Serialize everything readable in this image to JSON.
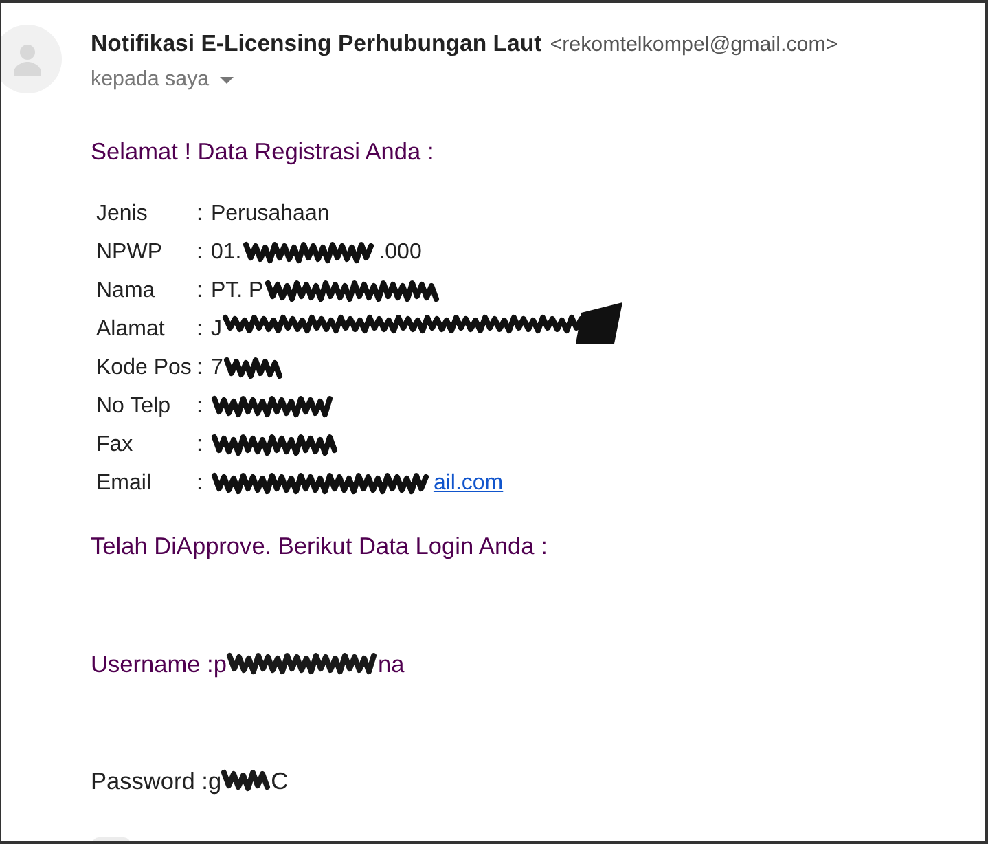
{
  "sender": {
    "name": "Notifikasi E-Licensing Perhubungan Laut",
    "email": "<rekomtelkompel@gmail.com>",
    "recipient": "kepada saya"
  },
  "body": {
    "greeting": "Selamat ! Data Registrasi Anda :",
    "fields": [
      {
        "label": "Jenis",
        "separator": ":",
        "kind": "text",
        "parts": [
          {
            "kind": "text",
            "text": "Perusahaan"
          }
        ]
      },
      {
        "label": "NPWP",
        "separator": ":",
        "kind": "text",
        "parts": [
          {
            "kind": "text",
            "text": "01."
          },
          {
            "kind": "redaction"
          },
          {
            "kind": "text",
            "text": ".000"
          }
        ]
      },
      {
        "label": "Nama",
        "separator": ":",
        "kind": "text",
        "parts": [
          {
            "kind": "text",
            "text": "PT. P"
          },
          {
            "kind": "redaction"
          }
        ]
      },
      {
        "label": "Alamat",
        "separator": ":",
        "kind": "text",
        "parts": [
          {
            "kind": "text",
            "text": "J"
          },
          {
            "kind": "redaction"
          }
        ]
      },
      {
        "label": "Kode Pos",
        "separator": ":",
        "kind": "text",
        "parts": [
          {
            "kind": "text",
            "text": "7"
          },
          {
            "kind": "redaction"
          }
        ]
      },
      {
        "label": "No Telp",
        "separator": ":",
        "kind": "text",
        "parts": [
          {
            "kind": "redaction"
          }
        ]
      },
      {
        "label": "Fax",
        "separator": ":",
        "kind": "text",
        "parts": [
          {
            "kind": "redaction"
          }
        ]
      },
      {
        "label": "Email",
        "separator": ":",
        "kind": "link",
        "parts": [
          {
            "kind": "redaction"
          },
          {
            "kind": "text",
            "text": "ail.com"
          }
        ]
      }
    ],
    "approval": "Telah DiApprove. Berikut Data Login Anda :",
    "username": {
      "label": "Username :",
      "parts": [
        {
          "kind": "text",
          "text": "p"
        },
        {
          "kind": "redaction"
        },
        {
          "kind": "text",
          "text": "na"
        }
      ]
    },
    "password": {
      "label": "Password :",
      "parts": [
        {
          "kind": "text",
          "text": "g"
        },
        {
          "kind": "redaction"
        },
        {
          "kind": "text",
          "text": "C"
        }
      ]
    }
  }
}
